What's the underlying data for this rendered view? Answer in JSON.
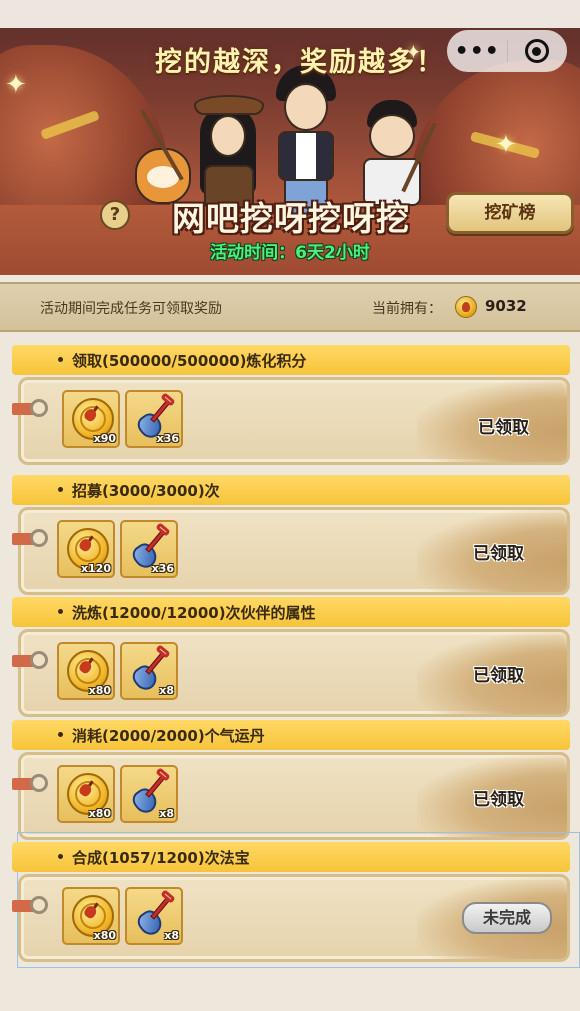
{
  "banner": {
    "slogan": "挖的越深，奖励越多！",
    "event_title": "网吧挖呀挖呀挖",
    "event_time": "活动时间：6天2小时",
    "rank_button": "挖矿榜",
    "help_icon_glyph": "?",
    "menu_more_glyph": "•••"
  },
  "info_bar": {
    "description": "活动期间完成任务可领取奖励",
    "owned_label": "当前拥有：",
    "owned_value": "9032"
  },
  "tasks": [
    {
      "label": "领取(500000/500000)炼化积分",
      "rewards": [
        {
          "icon": "shovel-coin-icon",
          "qty": "x90"
        },
        {
          "icon": "shovel-icon",
          "qty": "x36"
        }
      ],
      "status": "已领取"
    },
    {
      "label": "招募(3000/3000)次",
      "rewards": [
        {
          "icon": "shovel-coin-icon",
          "qty": "x120"
        },
        {
          "icon": "shovel-icon",
          "qty": "x36"
        }
      ],
      "status": "已领取"
    },
    {
      "label": "洗炼(12000/12000)次伙伴的属性",
      "rewards": [
        {
          "icon": "shovel-coin-icon",
          "qty": "x80"
        },
        {
          "icon": "shovel-icon",
          "qty": "x8"
        }
      ],
      "status": "已领取"
    },
    {
      "label": "消耗(2000/2000)个气运丹",
      "rewards": [
        {
          "icon": "shovel-coin-icon",
          "qty": "x80"
        },
        {
          "icon": "shovel-icon",
          "qty": "x8"
        }
      ],
      "status": "已领取"
    },
    {
      "label": "合成(1057/1200)次法宝",
      "rewards": [
        {
          "icon": "shovel-coin-icon",
          "qty": "x80"
        },
        {
          "icon": "shovel-icon",
          "qty": "x8"
        }
      ],
      "status": "未完成"
    }
  ],
  "colors": {
    "header_yellow": "#f6c43a",
    "card_bg": "#e6d3ac",
    "time_green": "#4df07a",
    "banner_brown": "#7a3c30"
  }
}
